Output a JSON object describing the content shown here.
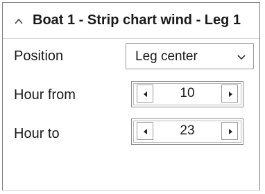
{
  "panel": {
    "title": "Boat 1 - Strip chart wind - Leg 1",
    "collapse_icon": "chevron-up-icon"
  },
  "position": {
    "label": "Position",
    "selected": "Leg center",
    "dropdown_icon": "chevron-down-icon"
  },
  "hour_from": {
    "label": "Hour from",
    "value": "10"
  },
  "hour_to": {
    "label": "Hour to",
    "value": "23"
  },
  "colors": {
    "text": "#1a1a1a",
    "border": "#8a8a8a",
    "background": "#ffffff"
  }
}
